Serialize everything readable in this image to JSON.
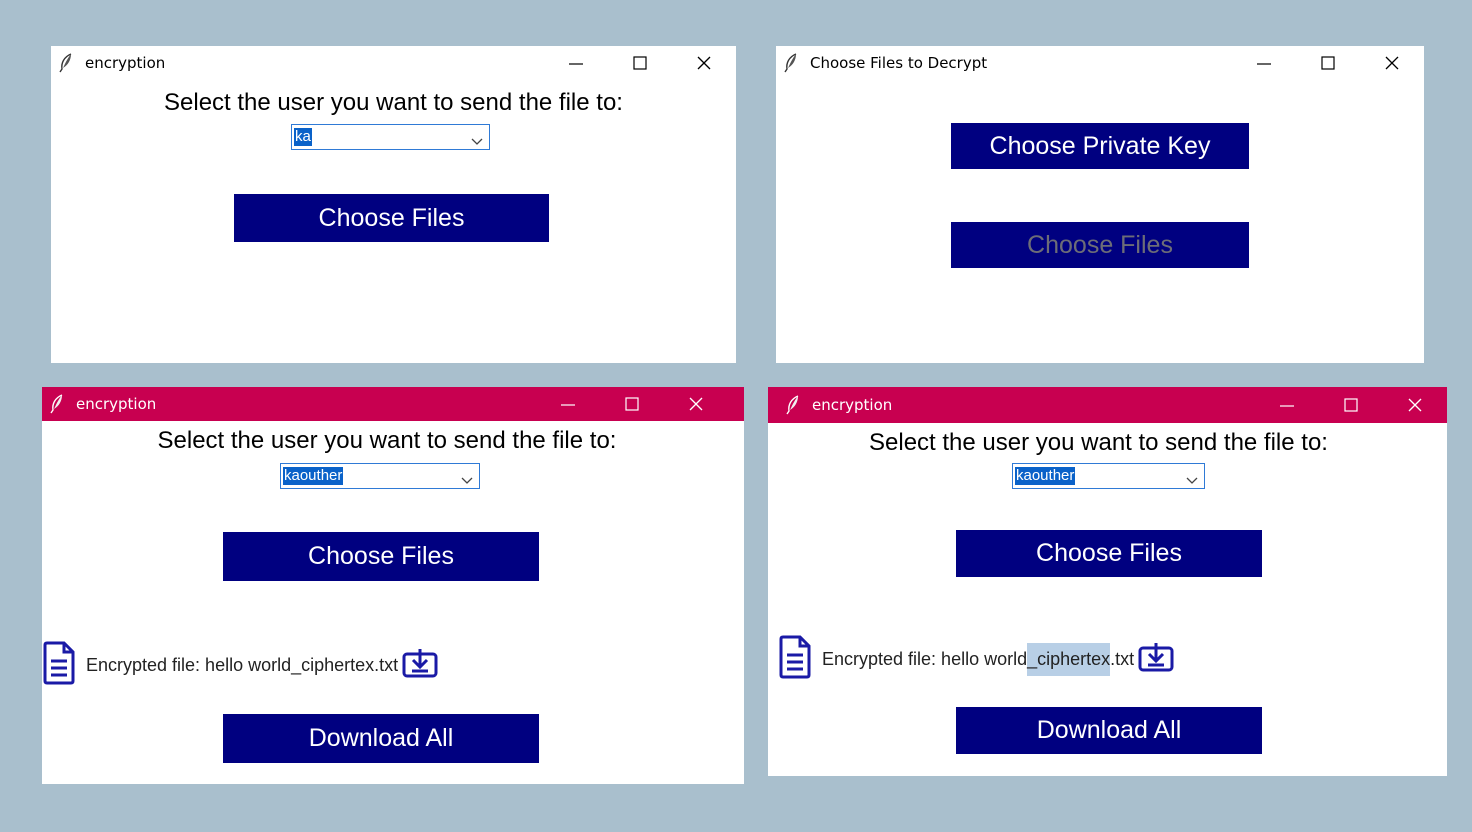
{
  "colors": {
    "desktop": "#a9bfcd",
    "button_bg": "#000080",
    "button_text": "#ffffff",
    "button_disabled_text": "#6d6d77",
    "active_titlebar": "#c80050",
    "selection": "#0a62c9"
  },
  "window1": {
    "title": "encryption",
    "prompt": "Select the user you want to send the file to:",
    "user_select_value": "ka",
    "choose_files_label": "Choose Files"
  },
  "window2": {
    "title": "Choose Files to Decrypt",
    "choose_private_key_label": "Choose Private Key",
    "choose_files_label": "Choose Files"
  },
  "window3": {
    "title": "encryption",
    "prompt": "Select the user you want to send the file to:",
    "user_select_value": "kaouther",
    "choose_files_label": "Choose Files",
    "file_label": "Encrypted file: hello world_ciphertex.txt",
    "download_all_label": "Download All"
  },
  "window4": {
    "title": "encryption",
    "prompt": "Select the user you want to send the file to:",
    "user_select_value": "kaouther",
    "choose_files_label": "Choose Files",
    "file_label_prefix": "Encrypted file: hello world",
    "file_label_highlight": "_ciphertex",
    "file_label_suffix": ".txt",
    "download_all_label": "Download All"
  },
  "icons": {
    "app": "feather-icon",
    "minimize": "minimize-icon",
    "maximize": "maximize-icon",
    "close": "close-icon",
    "dropdown": "chevron-down-icon",
    "file": "document-icon",
    "download": "download-icon"
  }
}
